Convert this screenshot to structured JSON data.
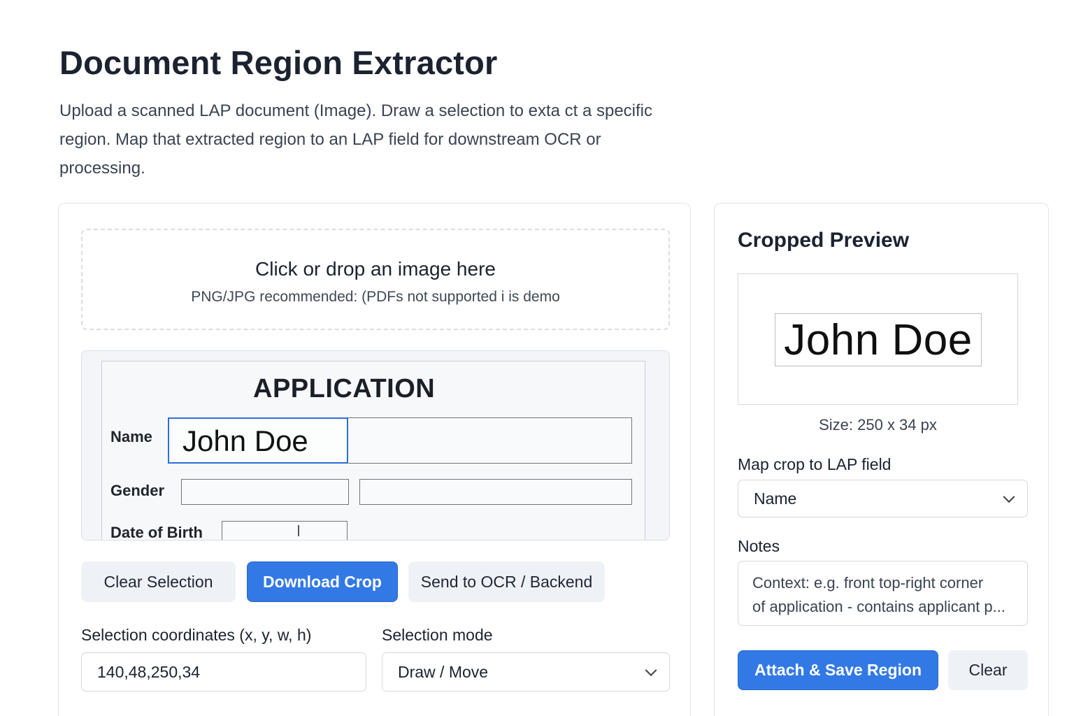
{
  "header": {
    "title": "Document Region Extractor",
    "description": "Upload a scanned LAP document (Image). Draw a selection to exta ct a specific region. Map that extracted region to an LAP field for downstream OCR or processing."
  },
  "dropzone": {
    "title": "Click or drop an image here",
    "subtitle": "PNG/JPG recommended: (PDFs not supported i is demo"
  },
  "document": {
    "title": "APPLICATION",
    "fields": {
      "name_label": "Name",
      "name_value": "John Doe",
      "gender_label": "Gender",
      "dob_label": "Date of Birth"
    }
  },
  "actions": {
    "clear_selection": "Clear Selection",
    "download_crop": "Download Crop",
    "send_ocr": "Send to OCR / Backend"
  },
  "selection": {
    "coords_label": "Selection coordinates (x, y, w, h)",
    "coords_value": "140,48,250,34",
    "mode_label": "Selection mode",
    "mode_value": "Draw / Move"
  },
  "preview": {
    "title": "Cropped Preview",
    "crop_text": "John Doe",
    "size_text": "Size: 250 x 34 px",
    "map_label": "Map crop to LAP field",
    "map_value": "Name",
    "notes_label": "Notes",
    "notes_line1": "Context: e.g. front top-right corner",
    "notes_line2": "of application - contains applicant p...",
    "attach_button": "Attach & Save Region",
    "clear_button": "Clear"
  },
  "colors": {
    "primary": "#3279e6",
    "selection": "#2f6fd6",
    "secondary_bg": "#eef2f7"
  }
}
